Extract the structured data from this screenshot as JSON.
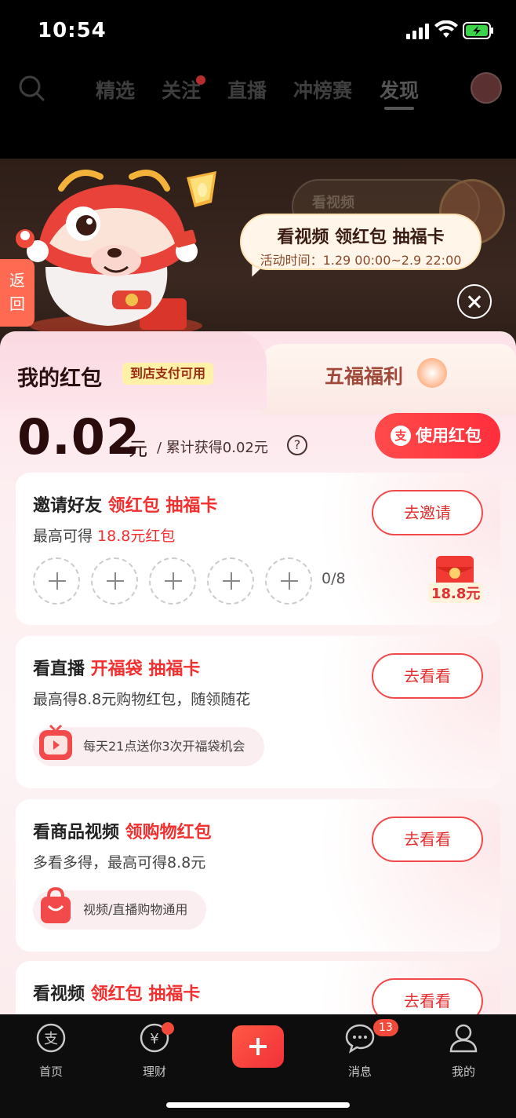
{
  "status_bar": {
    "time": "10:54"
  },
  "top_nav": {
    "tabs": [
      "精选",
      "关注",
      "直播",
      "冲榜赛",
      "发现"
    ],
    "active_tab": "发现"
  },
  "backdrop": {
    "ghost_text": "看视频"
  },
  "bubble": {
    "title": "看视频 领红包 抽福卡",
    "subtitle": "活动时间：1.29 00:00~2.9 22:00"
  },
  "return_tab": {
    "label_line1": "返",
    "label_line2": "回"
  },
  "panel": {
    "tab_left_title": "我的红包",
    "tab_left_badge": "到店支付可用",
    "tab_right_title": "五福福利",
    "balance": "0.02",
    "currency": "元",
    "total_earned": "/ 累计获得0.02元",
    "help_symbol": "?",
    "use_button_icon": "支",
    "use_button_label": "使用红包"
  },
  "cards": [
    {
      "title_black": "邀请好友 ",
      "title_red": "领红包 抽福卡",
      "sub_black": "最高可得 ",
      "sub_red": "18.8元红包",
      "button": "去邀请",
      "progress": "0/8",
      "reward": "18.8元"
    },
    {
      "title_black": "看直播 ",
      "title_red": "开福袋 抽福卡",
      "sub": "最高得8.8元购物红包，随领随花",
      "button": "去看看",
      "pill": "每天21点送你3次开福袋机会"
    },
    {
      "title_black": "看商品视频 ",
      "title_red": "领购物红包",
      "sub": "多看多得，最高可得8.8元",
      "button": "去看看",
      "pill": "视频/直播购物通用"
    },
    {
      "title_black": "看视频 ",
      "title_red": "领红包 抽福卡",
      "button": "去看看"
    }
  ],
  "bottom_bar": {
    "items": [
      "首页",
      "理财",
      "消息",
      "我的"
    ],
    "home_icon_char": "支",
    "finance_icon_char": "¥",
    "message_badge": "13"
  },
  "colors": {
    "accent": "#f23030",
    "panel_bg": "#fdeff1",
    "bar_bg": "#0d0d0d"
  }
}
